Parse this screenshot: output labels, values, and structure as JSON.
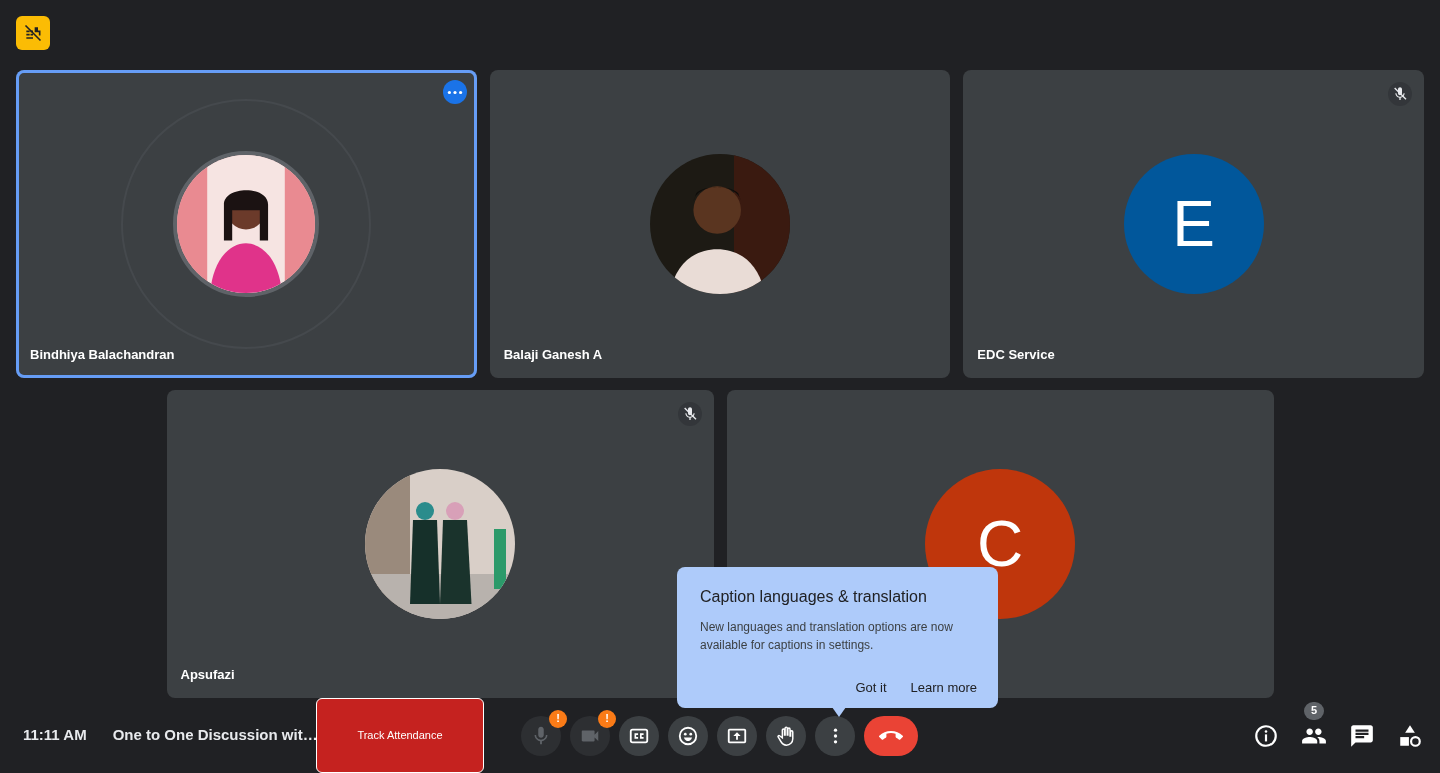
{
  "participants": [
    {
      "name": "Bindhiya Balachandran",
      "kind": "picture",
      "selected": true,
      "muted": false,
      "menu": true
    },
    {
      "name": "Balaji Ganesh A",
      "kind": "picture",
      "selected": false,
      "muted": false,
      "menu": false
    },
    {
      "name": "EDC Service",
      "kind": "letter",
      "letter": "E",
      "color": "#01579b",
      "selected": false,
      "muted": true,
      "menu": false
    },
    {
      "name": "Apsufazi",
      "kind": "picture",
      "selected": false,
      "muted": true,
      "menu": false
    },
    {
      "kind": "letter",
      "letter": "C",
      "color": "#bf360c",
      "selected": false,
      "muted": false,
      "menu": false
    }
  ],
  "meeting": {
    "time": "11:11 AM",
    "title": "One to One Discussion wit…"
  },
  "track_button": "Track Attendance",
  "controls": [
    {
      "kind": "mic",
      "disabled": true,
      "badge": "!"
    },
    {
      "kind": "camera",
      "disabled": true,
      "badge": "!"
    },
    {
      "kind": "captions",
      "disabled": false
    },
    {
      "kind": "emoji",
      "disabled": false
    },
    {
      "kind": "present",
      "disabled": false
    },
    {
      "kind": "hand",
      "disabled": false
    },
    {
      "kind": "more",
      "disabled": false
    },
    {
      "kind": "end",
      "disabled": false
    }
  ],
  "side_controls": [
    {
      "kind": "info"
    },
    {
      "kind": "people",
      "badge": "5"
    },
    {
      "kind": "chat"
    },
    {
      "kind": "activities"
    }
  ],
  "tooltip": {
    "title": "Caption languages & translation",
    "body": "New languages and translation options are now available for captions in settings.",
    "actions": [
      "Got it",
      "Learn more"
    ]
  }
}
